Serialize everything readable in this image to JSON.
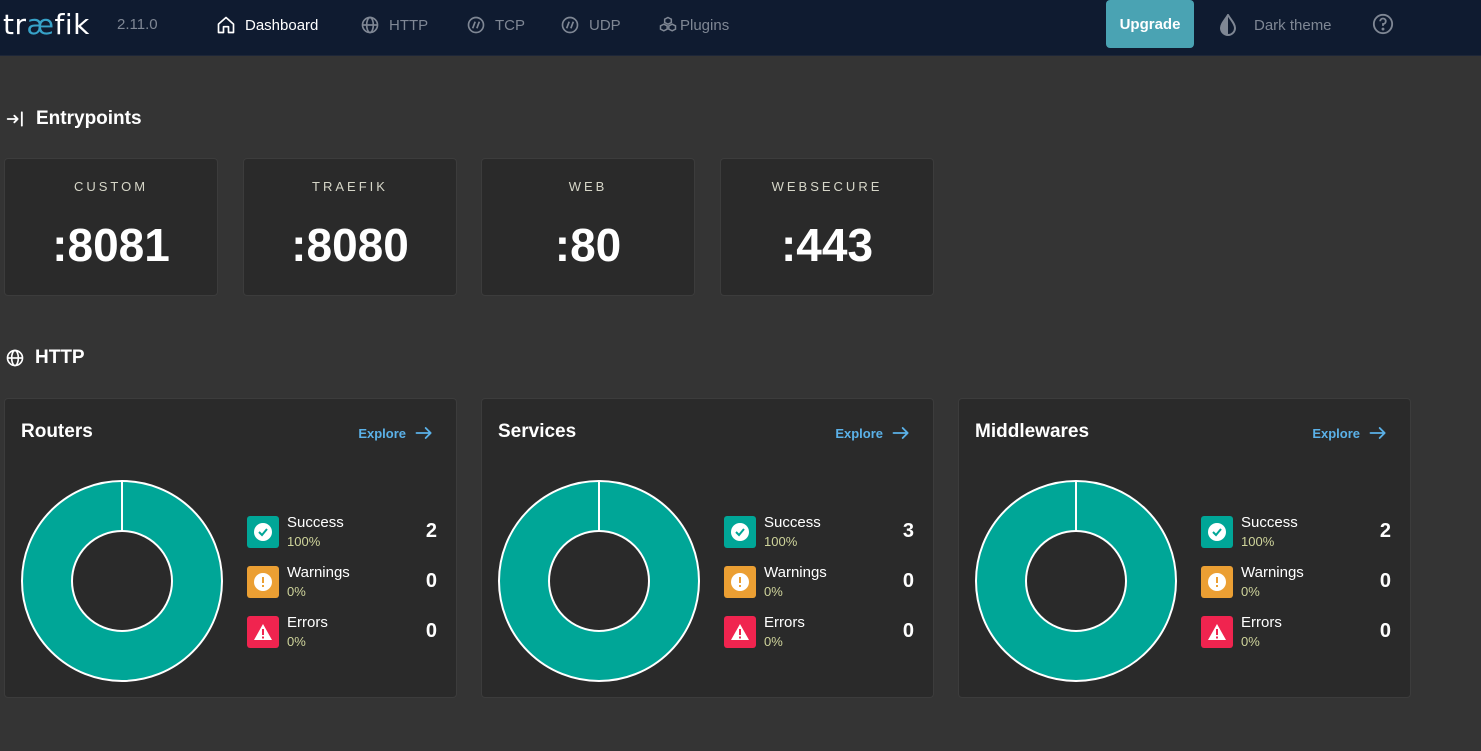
{
  "header": {
    "logo_prefix": "tr",
    "logo_ae": "æ",
    "logo_suffix": "fik",
    "version": "2.11.0",
    "nav": [
      {
        "label": "Dashboard",
        "icon": "home-icon",
        "active": true
      },
      {
        "label": "HTTP",
        "icon": "globe-icon",
        "active": false
      },
      {
        "label": "TCP",
        "icon": "tcp-icon",
        "active": false
      },
      {
        "label": "UDP",
        "icon": "udp-icon",
        "active": false
      },
      {
        "label": "Plugins",
        "icon": "plugins-icon",
        "active": false
      }
    ],
    "upgrade_label": "Upgrade",
    "theme_label": "Dark theme"
  },
  "entrypoints": {
    "title": "Entrypoints",
    "items": [
      {
        "name": "CUSTOM",
        "port": ":8081"
      },
      {
        "name": "TRAEFIK",
        "port": ":8080"
      },
      {
        "name": "WEB",
        "port": ":80"
      },
      {
        "name": "WEBSECURE",
        "port": ":443"
      }
    ]
  },
  "http": {
    "title": "HTTP",
    "cards": [
      {
        "title": "Routers",
        "explore": "Explore",
        "success_label": "Success",
        "success_pct": "100%",
        "success_count": "2",
        "warnings_label": "Warnings",
        "warnings_pct": "0%",
        "warnings_count": "0",
        "errors_label": "Errors",
        "errors_pct": "0%",
        "errors_count": "0"
      },
      {
        "title": "Services",
        "explore": "Explore",
        "success_label": "Success",
        "success_pct": "100%",
        "success_count": "3",
        "warnings_label": "Warnings",
        "warnings_pct": "0%",
        "warnings_count": "0",
        "errors_label": "Errors",
        "errors_pct": "0%",
        "errors_count": "0"
      },
      {
        "title": "Middlewares",
        "explore": "Explore",
        "success_label": "Success",
        "success_pct": "100%",
        "success_count": "2",
        "warnings_label": "Warnings",
        "warnings_pct": "0%",
        "warnings_count": "0",
        "errors_label": "Errors",
        "errors_pct": "0%",
        "errors_count": "0"
      }
    ]
  },
  "colors": {
    "success": "#00a697",
    "warning": "#eb9f33",
    "error": "#f0244f",
    "accent": "#4aa3b3",
    "link": "#5bb1e8"
  }
}
